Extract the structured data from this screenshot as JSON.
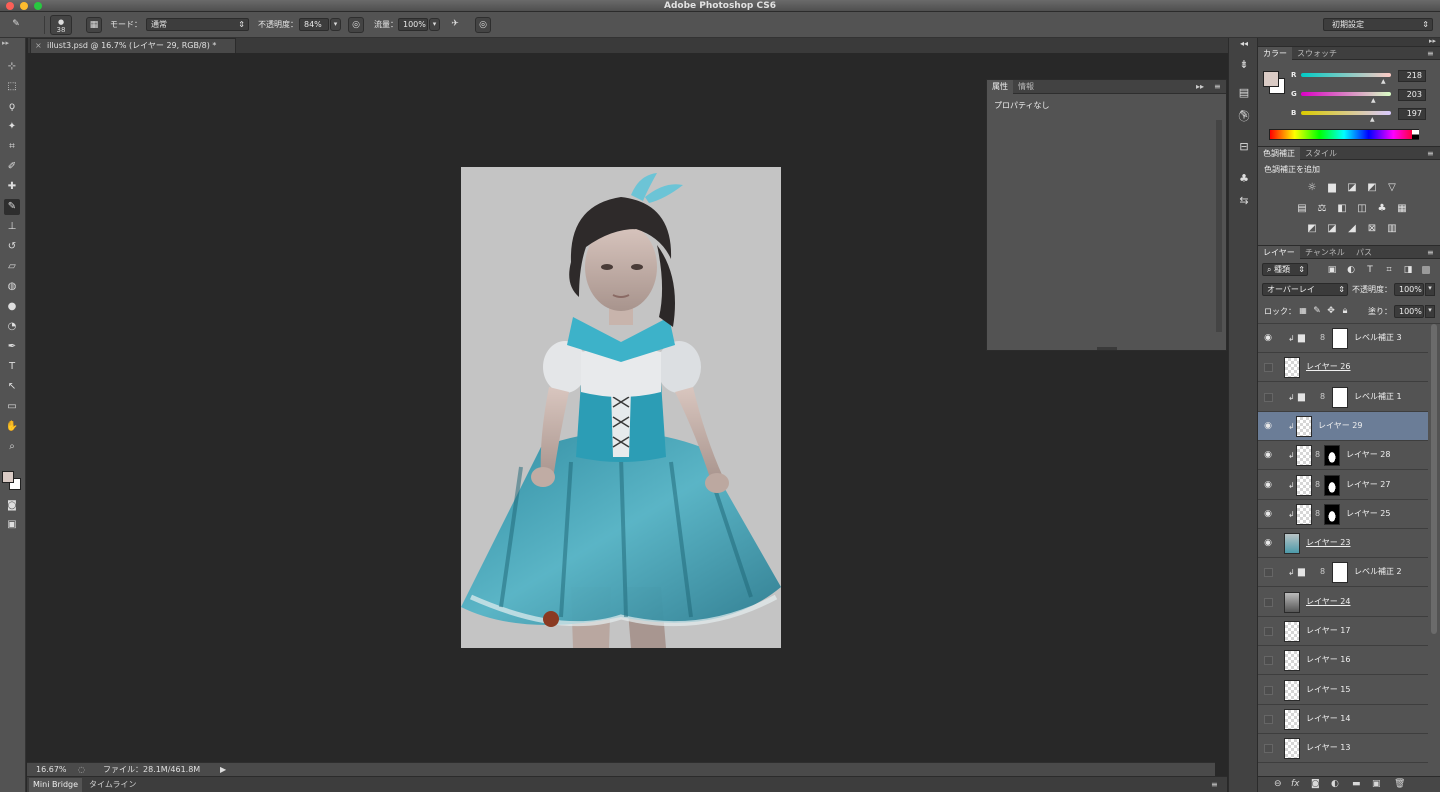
{
  "app": {
    "title": "Adobe Photoshop CS6"
  },
  "options_bar": {
    "brush_size": "38",
    "mode_label": "モード：",
    "mode_value": "通常",
    "opacity_label": "不透明度：",
    "opacity_value": "84%",
    "flow_label": "流量：",
    "flow_value": "100%",
    "workspace": "初期設定"
  },
  "document_tab": {
    "label": "illust3.psd @ 16.7% (レイヤー 29, RGB/8) *"
  },
  "properties_panel": {
    "tabs": [
      "属性",
      "情報"
    ],
    "content": "プロパティなし"
  },
  "status_bar": {
    "zoom": "16.67%",
    "file_info": "ファイル：28.1M/461.8M"
  },
  "bottom_tabs": [
    "Mini Bridge",
    "タイムライン"
  ],
  "color_panel": {
    "tabs": [
      "カラー",
      "スウォッチ"
    ],
    "r_label": "R",
    "g_label": "G",
    "b_label": "B",
    "r": "218",
    "g": "203",
    "b": "197",
    "fg_color": "#dacbc5",
    "bg_color": "#ffffff"
  },
  "adjustments_panel": {
    "tabs": [
      "色調補正",
      "スタイル"
    ],
    "heading": "色調補正を追加"
  },
  "layers_panel": {
    "tabs": [
      "レイヤー",
      "チャンネル",
      "パス"
    ],
    "filter_kind": "種類",
    "blend_mode": "オーバーレイ",
    "opacity_label": "不透明度：",
    "opacity_value": "100%",
    "lock_label": "ロック：",
    "fill_label": "塗り：",
    "fill_value": "100%",
    "layers": [
      {
        "name": "レベル補正 3",
        "kind": "adjustment",
        "visible": true,
        "clipped": true,
        "selected": false,
        "underline": false
      },
      {
        "name": "レイヤー 26",
        "kind": "pixel",
        "visible": false,
        "clipped": false,
        "selected": false,
        "underline": true
      },
      {
        "name": "レベル補正 1",
        "kind": "adjustment",
        "visible": false,
        "clipped": true,
        "selected": false,
        "underline": false
      },
      {
        "name": "レイヤー 29",
        "kind": "pixel",
        "visible": true,
        "clipped": true,
        "selected": true,
        "underline": false
      },
      {
        "name": "レイヤー 28",
        "kind": "masked",
        "visible": true,
        "clipped": true,
        "selected": false,
        "underline": false
      },
      {
        "name": "レイヤー 27",
        "kind": "masked",
        "visible": true,
        "clipped": true,
        "selected": false,
        "underline": false
      },
      {
        "name": "レイヤー 25",
        "kind": "masked",
        "visible": true,
        "clipped": true,
        "selected": false,
        "underline": false
      },
      {
        "name": "レイヤー 23",
        "kind": "image",
        "visible": true,
        "clipped": false,
        "selected": false,
        "underline": true
      },
      {
        "name": "レベル補正 2",
        "kind": "adjustment",
        "visible": false,
        "clipped": true,
        "selected": false,
        "underline": false
      },
      {
        "name": "レイヤー 24",
        "kind": "image-dark",
        "visible": false,
        "clipped": false,
        "selected": false,
        "underline": true
      },
      {
        "name": "レイヤー 17",
        "kind": "pixel",
        "visible": false,
        "clipped": false,
        "selected": false,
        "underline": false
      },
      {
        "name": "レイヤー 16",
        "kind": "pixel",
        "visible": false,
        "clipped": false,
        "selected": false,
        "underline": false
      },
      {
        "name": "レイヤー 15",
        "kind": "pixel",
        "visible": false,
        "clipped": false,
        "selected": false,
        "underline": false
      },
      {
        "name": "レイヤー 14",
        "kind": "pixel",
        "visible": false,
        "clipped": false,
        "selected": false,
        "underline": false
      },
      {
        "name": "レイヤー 13",
        "kind": "pixel",
        "visible": false,
        "clipped": false,
        "selected": false,
        "underline": false
      }
    ]
  },
  "tools": [
    "move-tool",
    "marquee-tool",
    "lasso-tool",
    "quick-select-tool",
    "crop-tool",
    "eyedropper-tool",
    "healing-tool",
    "brush-tool",
    "clone-stamp-tool",
    "history-brush-tool",
    "eraser-tool",
    "paint-bucket-tool",
    "blur-tool",
    "dodge-tool",
    "pen-tool",
    "type-tool",
    "path-select-tool",
    "shape-tool",
    "hand-tool",
    "zoom-tool"
  ]
}
